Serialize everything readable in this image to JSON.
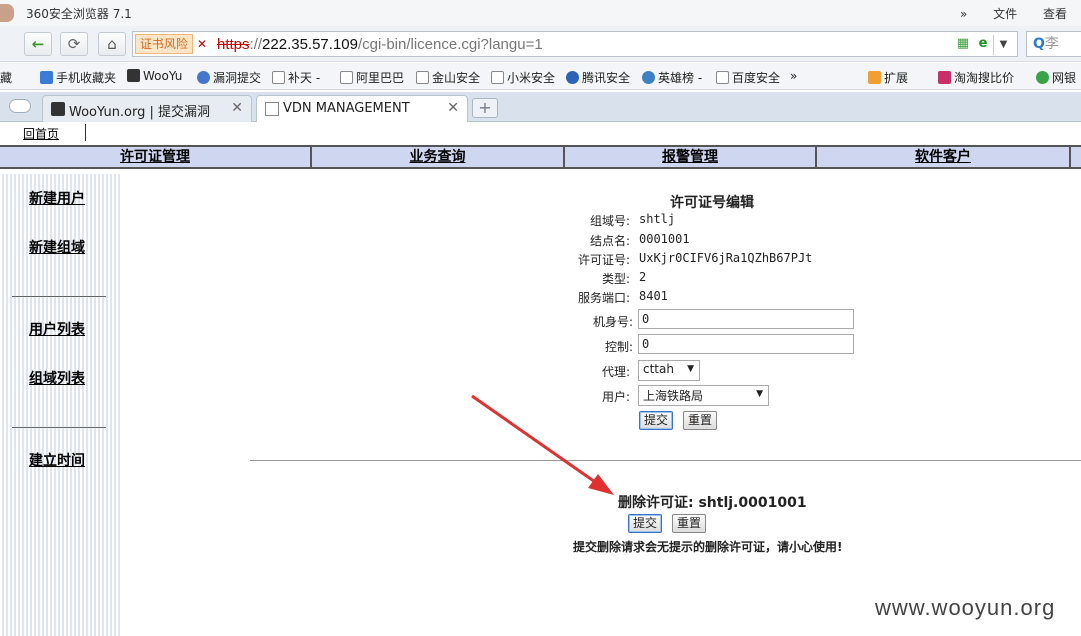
{
  "browser": {
    "title": "360安全浏览器 7.1",
    "menu_right": [
      "文件",
      "查看"
    ],
    "cert_warning": "证书风险",
    "url": {
      "scheme": "https",
      "separator": "://",
      "host": "222.35.57.109",
      "path": "/cgi-bin/licence.cgi?langu=1"
    },
    "search_placeholder": "李",
    "bookmarks": [
      "藏",
      "手机收藏夹",
      "WooYu",
      "漏洞提交",
      "补天 -",
      "阿里巴巴",
      "金山安全",
      "小米安全",
      "腾讯安全",
      "英雄榜 -",
      "百度安全",
      "»",
      "扩展",
      "淘淘搜比价",
      "网银"
    ],
    "tabs": [
      {
        "label": "WooYun.org | 提交漏洞"
      },
      {
        "label": "VDN MANAGEMENT"
      }
    ],
    "new_tab": "+"
  },
  "page": {
    "home_link": "回首页",
    "menu": [
      "许可证管理",
      "业务查询",
      "报警管理",
      "软件客户"
    ],
    "sidebar": [
      "新建用户",
      "新建组域",
      "用户列表",
      "组域列表",
      "建立时间"
    ],
    "form": {
      "title": "许可证号编辑",
      "fields": [
        {
          "label": "组域号:",
          "value": "shtlj"
        },
        {
          "label": "结点名:",
          "value": "0001001"
        },
        {
          "label": "许可证号:",
          "value": "UxKjr0CIFV6jRa1QZhB67PJt"
        },
        {
          "label": "类型:",
          "value": "2"
        },
        {
          "label": "服务端口:",
          "value": "8401"
        }
      ],
      "machine_label": "机身号:",
      "machine_value": "0",
      "control_label": "控制:",
      "control_value": "0",
      "agent_label": "代理:",
      "agent_value": "cttah",
      "user_label": "用户:",
      "user_value": "上海铁路局",
      "submit": "提交",
      "reset": "重置"
    },
    "delete": {
      "title": "删除许可证: shtlj.0001001",
      "submit": "提交",
      "reset": "重置",
      "warning": "提交删除请求会无提示的删除许可证，请小心使用!"
    },
    "watermark": "www.wooyun.org"
  },
  "colors": {
    "menu_bg": "#cfd6f0",
    "arrow": "#e03030",
    "cert_warn": "#d2691e"
  }
}
